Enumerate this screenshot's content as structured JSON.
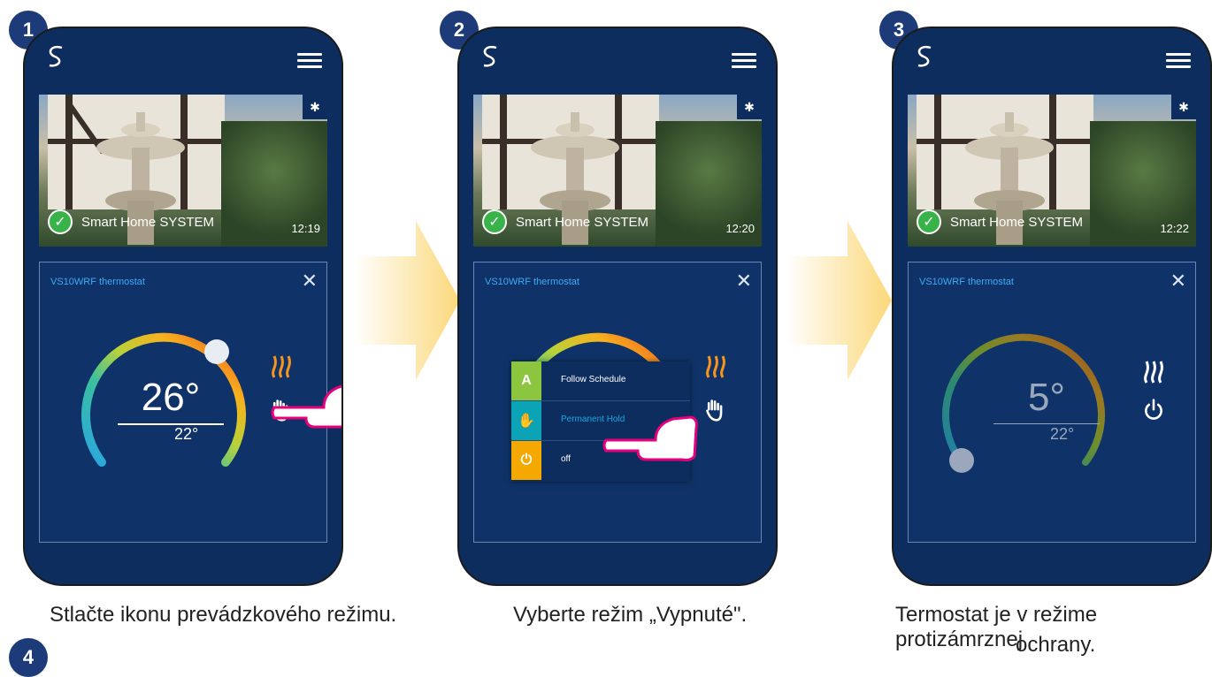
{
  "steps": [
    {
      "number": "1",
      "hero": {
        "system_name": "Smart Home SYSTEM",
        "time": "12:19"
      },
      "card": {
        "title": "VS10WRF thermostat",
        "temperature": "26°",
        "setpoint": "22°"
      },
      "caption": "Stlačte ikonu prevádzkového režimu."
    },
    {
      "number": "2",
      "hero": {
        "system_name": "Smart Home SYSTEM",
        "time": "12:20"
      },
      "card": {
        "title": "VS10WRF thermostat"
      },
      "popup": {
        "items": [
          {
            "label": "Follow Schedule",
            "icon": "auto-schedule-icon"
          },
          {
            "label": "Permanent Hold",
            "icon": "hand-hold-icon"
          },
          {
            "label": "off",
            "icon": "power-icon"
          }
        ]
      },
      "caption": "Vyberte režim „Vypnuté\"."
    },
    {
      "number": "3",
      "hero": {
        "system_name": "Smart Home SYSTEM",
        "time": "12:22"
      },
      "card": {
        "title": "VS10WRF thermostat",
        "temperature": "5°",
        "setpoint": "22°"
      },
      "caption_line1": "Termostat je v režime protizámrznej",
      "caption_line2": "ochrany."
    }
  ],
  "next_step_number": "4",
  "colors": {
    "brand": "#0d2d5e",
    "badge": "#1d3b78",
    "heat": "#f7941d",
    "arrow": "#fbd87a"
  }
}
